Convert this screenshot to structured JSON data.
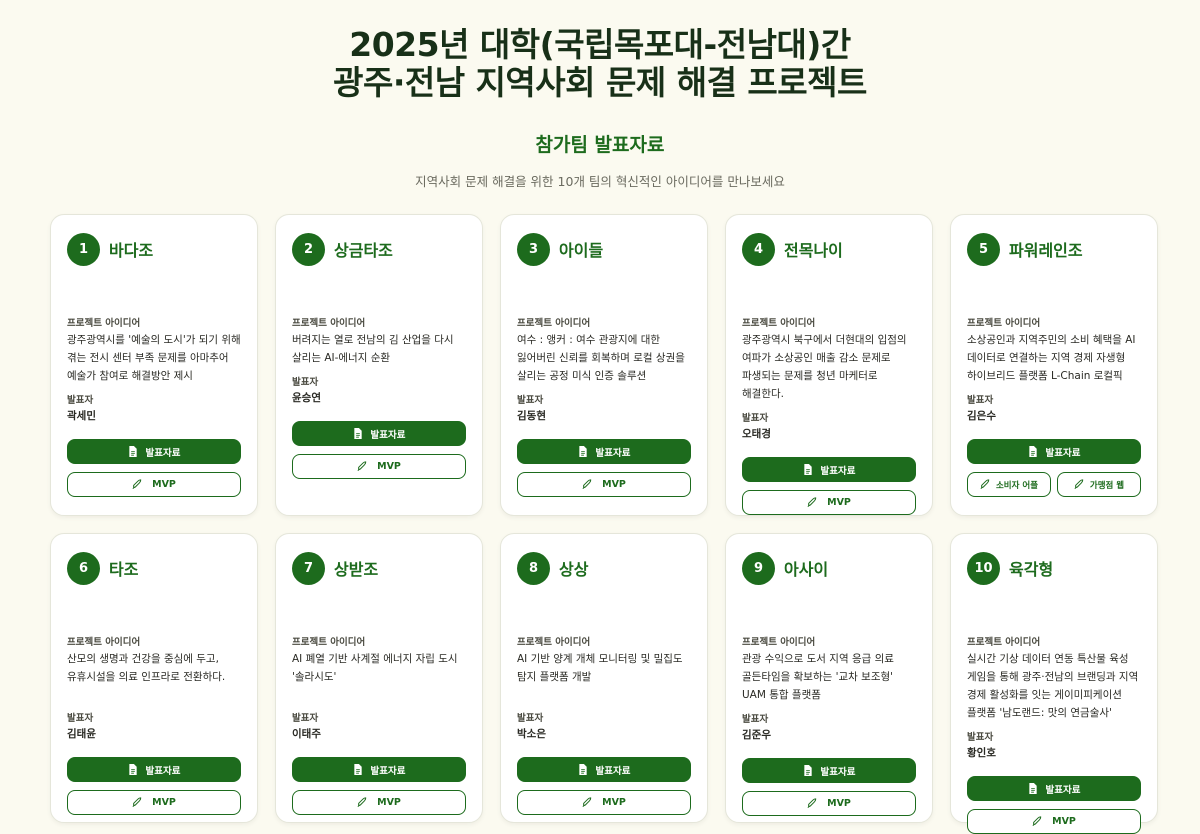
{
  "header": {
    "title_line1": "2025년 대학(국립목포대-전남대)간",
    "title_line2": "광주·전남 지역사회 문제 해결 프로젝트",
    "subtitle": "참가팀 발표자료",
    "description": "지역사회 문제 해결을 위한 10개 팀의 혁신적인 아이디어를 만나보세요"
  },
  "labels": {
    "idea": "프로젝트 아이디어",
    "presenter": "발표자",
    "slides": "발표자료",
    "mvp": "MVP"
  },
  "teams": [
    {
      "num": "1",
      "name": "바다조",
      "idea": "광주광역시를 '예술의 도시'가 되기 위해 겪는 전시 센터 부족 문제를 아마추어 예술가 참여로 해결방안 제시",
      "presenter": "곽세민"
    },
    {
      "num": "2",
      "name": "상금타조",
      "idea": "버려지는 열로 전남의 김 산업을 다시 살리는 AI-에너지 순환",
      "presenter": "윤승연"
    },
    {
      "num": "3",
      "name": "아이들",
      "idea": "여수 : 앵커 : 여수 관광지에 대한 잃어버린 신뢰를 회복하며 로컬 상권을 살리는 공정 미식 인증 솔루션",
      "presenter": "김동현"
    },
    {
      "num": "4",
      "name": "전목나이",
      "idea": "광주광역시 북구에서 더현대의 입점의 여파가 소상공인 매출 감소 문제로 파생되는 문제를 청년 마케터로 해결한다.",
      "presenter": "오태경"
    },
    {
      "num": "5",
      "name": "파워레인조",
      "idea": "소상공인과 지역주민의 소비 혜택을 AI 데이터로 연결하는 지역 경제 자생형 하이브리드 플랫폼 L-Chain 로컬픽",
      "presenter": "김은수",
      "mvp_left": "소비자 어플",
      "mvp_right": "가맹점 웹"
    },
    {
      "num": "6",
      "name": "타조",
      "idea": "산모의 생명과 건강을 중심에 두고, 유휴시설을 의료 인프라로 전환하다.",
      "presenter": "김태윤"
    },
    {
      "num": "7",
      "name": "상받조",
      "idea": "AI 폐열 기반 사계절 에너지 자립 도시 '솔라시도'",
      "presenter": "이태주"
    },
    {
      "num": "8",
      "name": "상상",
      "idea": "AI 기반 양계 개체 모니터링 및 밀집도 탐지 플랫폼 개발",
      "presenter": "박소은"
    },
    {
      "num": "9",
      "name": "아사이",
      "idea": "관광 수익으로 도서 지역 응급 의료 골든타임을 확보하는 '교차 보조형' UAM 통합 플랫폼",
      "presenter": "김준우"
    },
    {
      "num": "10",
      "name": "육각형",
      "idea": "실시간 기상 데이터 연동 특산물 육성 게임을 통해 광주·전남의 브랜딩과 지역 경제 활성화를 잇는 게이미피케이션 플랫폼 '남도랜드: 맛의 연금술사'",
      "presenter": "황인호"
    }
  ]
}
